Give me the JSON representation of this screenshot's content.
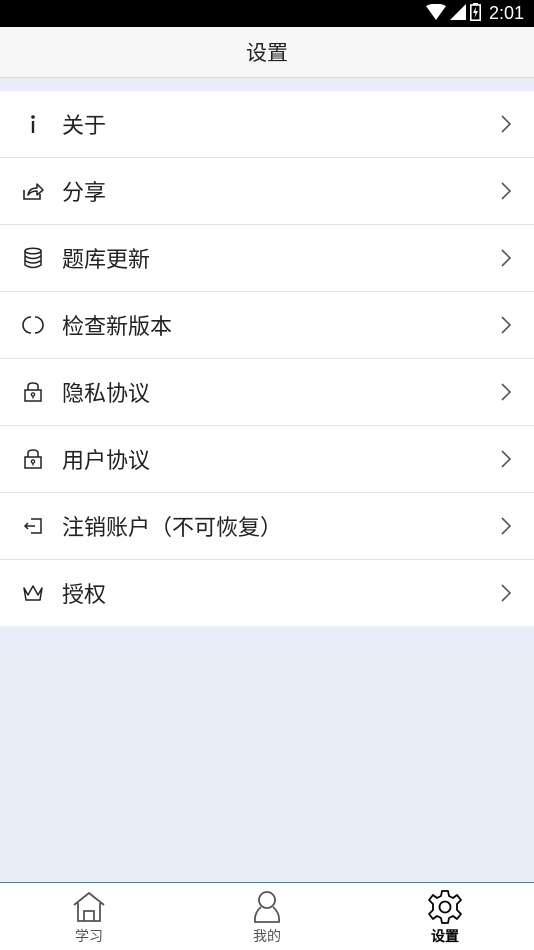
{
  "status_bar": {
    "time": "2:01",
    "icons": [
      "wifi-icon",
      "signal-icon",
      "battery-icon"
    ]
  },
  "header": {
    "title": "设置"
  },
  "menu": {
    "items": [
      {
        "icon": "info-icon",
        "label": "关于"
      },
      {
        "icon": "share-icon",
        "label": "分享"
      },
      {
        "icon": "database-icon",
        "label": "题库更新"
      },
      {
        "icon": "refresh-icon",
        "label": "检查新版本"
      },
      {
        "icon": "lock-icon",
        "label": "隐私协议"
      },
      {
        "icon": "lock-icon",
        "label": "用户协议"
      },
      {
        "icon": "logout-icon",
        "label": "注销账户（不可恢复）"
      },
      {
        "icon": "crown-icon",
        "label": "授权"
      }
    ]
  },
  "bottom_nav": {
    "items": [
      {
        "icon": "home-icon",
        "label": "学习",
        "active": false
      },
      {
        "icon": "user-icon",
        "label": "我的",
        "active": false
      },
      {
        "icon": "gear-icon",
        "label": "设置",
        "active": true
      }
    ]
  },
  "colors": {
    "background": "#e9edf8",
    "nav_border": "#2f8f86",
    "text": "#222222"
  }
}
